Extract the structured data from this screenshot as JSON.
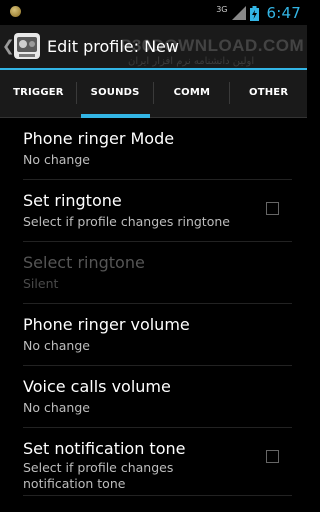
{
  "status_bar": {
    "network": "3G",
    "battery_icon": "battery-charging-icon",
    "time": "6:47",
    "accent_color": "#33b5e5"
  },
  "action_bar": {
    "title": "Edit profile: New",
    "watermark": "P30DOWNLOAD.COM",
    "watermark_sub": "اولین دانشنامه نرم افزار ایران"
  },
  "tabs": [
    {
      "label": "TRIGGER",
      "selected": false
    },
    {
      "label": "SOUNDS",
      "selected": true
    },
    {
      "label": "COMM",
      "selected": false
    },
    {
      "label": "OTHER",
      "selected": false
    }
  ],
  "preferences": [
    {
      "title": "Phone ringer Mode",
      "summary": "No change"
    },
    {
      "title": "Set ringtone",
      "summary": "Select if profile changes ringtone",
      "checked": false
    },
    {
      "title": "Select ringtone",
      "summary": "Silent",
      "enabled": false
    },
    {
      "title": "Phone ringer volume",
      "summary": "No change"
    },
    {
      "title": "Voice calls volume",
      "summary": "No change"
    },
    {
      "title": "Set notification tone",
      "summary": "Select if profile changes notification tone",
      "checked": false
    }
  ]
}
